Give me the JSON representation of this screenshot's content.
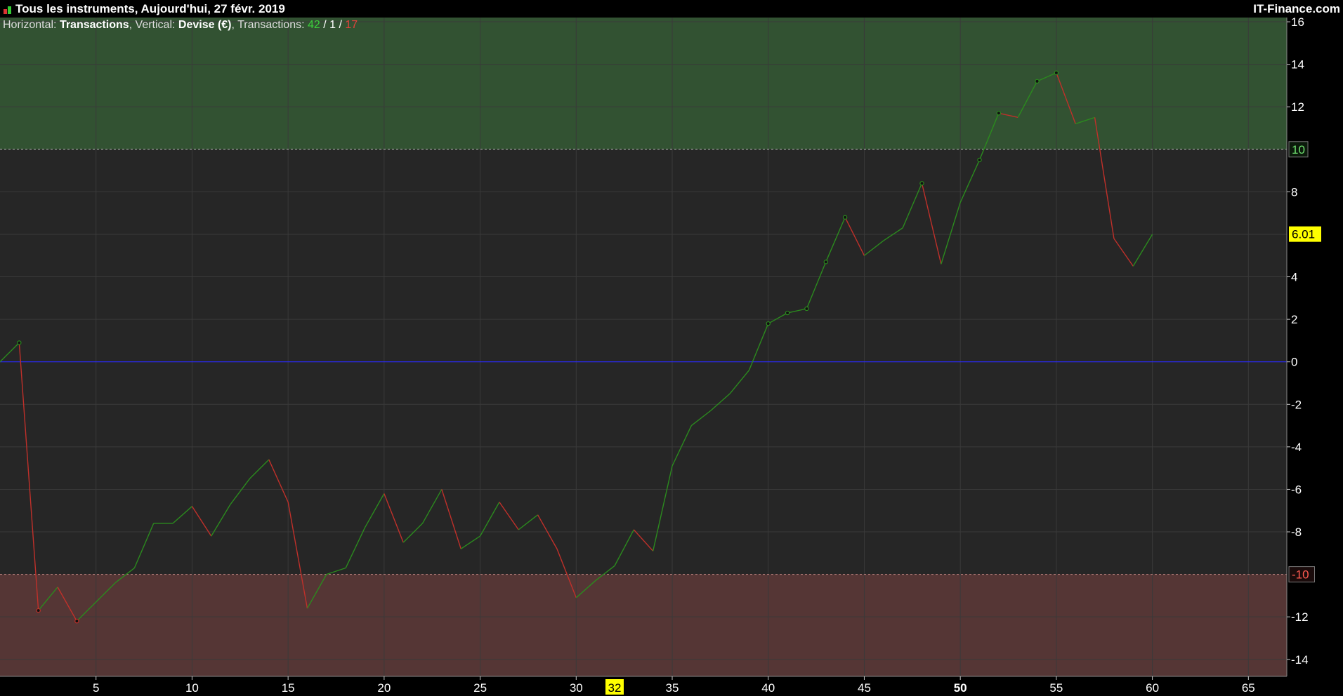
{
  "header": {
    "title": "Tous les instruments, Aujourd'hui, 27 févr. 2019",
    "brand": "IT-Finance.com"
  },
  "info": {
    "horizontal_label": "Horizontal:",
    "horizontal_value": "Transactions",
    "vertical_label": ", Vertical:",
    "vertical_value": "Devise (€)",
    "transactions_label": ", Transactions:",
    "wins": "42",
    "sep1": " / ",
    "neutral": "1",
    "sep2": " / ",
    "losses": "17"
  },
  "colors": {
    "up": "#2b8a1e",
    "down": "#c0302a",
    "zero_line": "#2a2aff",
    "green_zone": "#325232",
    "red_zone": "#553635",
    "plot_bg": "#262626",
    "highlight": "#ffff00"
  },
  "chart_data": {
    "type": "line",
    "xlabel": "",
    "ylabel": "",
    "xlim": [
      0,
      67
    ],
    "ylim": [
      -14.8,
      16.2
    ],
    "grid": true,
    "x_ticks": [
      5,
      10,
      15,
      20,
      25,
      30,
      35,
      40,
      45,
      50,
      55,
      60,
      65
    ],
    "x_tick_labels": [
      "5",
      "10",
      "15",
      "20",
      "25",
      "30",
      "35",
      "40",
      "45",
      "50",
      "55",
      "60",
      "65"
    ],
    "highlighted_x": {
      "value": 32,
      "label": "32"
    },
    "bold_x_tick": "50",
    "y_ticks": [
      16,
      14,
      12,
      8,
      4,
      2,
      0,
      -2,
      -4,
      -6,
      -8,
      -12,
      -14
    ],
    "y_tick_labels": [
      "16",
      "14",
      "12",
      "8",
      "4",
      "2",
      "0",
      "-2",
      "-4",
      "-6",
      "-8",
      "-12",
      "-14"
    ],
    "upper_threshold": {
      "value": 10,
      "label": "10"
    },
    "lower_threshold": {
      "value": -10,
      "label": "-10"
    },
    "last_value": {
      "value": 6.01,
      "label": "6.01"
    },
    "series": [
      {
        "x": [
          0,
          1,
          2,
          3,
          4,
          5,
          6,
          7,
          8,
          9,
          10,
          11,
          12,
          13,
          14,
          15,
          16,
          17,
          18,
          19,
          20,
          21,
          22,
          23,
          24,
          25,
          26,
          27,
          28,
          29,
          30,
          31,
          32,
          33,
          34,
          35,
          36,
          37,
          38,
          39,
          40,
          41,
          42,
          43,
          44,
          45,
          46,
          47,
          48,
          49,
          50,
          51,
          52,
          53,
          54,
          55,
          56,
          57,
          58,
          59,
          60
        ],
        "y": [
          0,
          0.9,
          -11.7,
          -10.6,
          -12.2,
          -11.3,
          -10.4,
          -9.7,
          -7.6,
          -7.6,
          -6.8,
          -8.2,
          -6.7,
          -5.5,
          -4.6,
          -6.6,
          -11.6,
          -10,
          -9.7,
          -7.8,
          -6.2,
          -8.5,
          -7.6,
          -6.0,
          -8.8,
          -8.2,
          -6.6,
          -7.9,
          -7.2,
          -8.8,
          -11.1,
          -10.3,
          -9.6,
          -7.9,
          -8.9,
          -4.9,
          -3.0,
          -2.3,
          -1.5,
          -0.4,
          1.8,
          2.3,
          2.5,
          4.7,
          6.8,
          5.0,
          5.7,
          6.3,
          8.4,
          4.6,
          7.5,
          9.5,
          11.7,
          11.5,
          13.2,
          13.6,
          11.2,
          11.5,
          5.8,
          4.5,
          6.0
        ]
      }
    ],
    "marker_points": [
      1,
      2,
      4,
      40,
      41,
      42,
      43,
      44,
      48,
      51,
      52,
      54,
      55
    ]
  }
}
